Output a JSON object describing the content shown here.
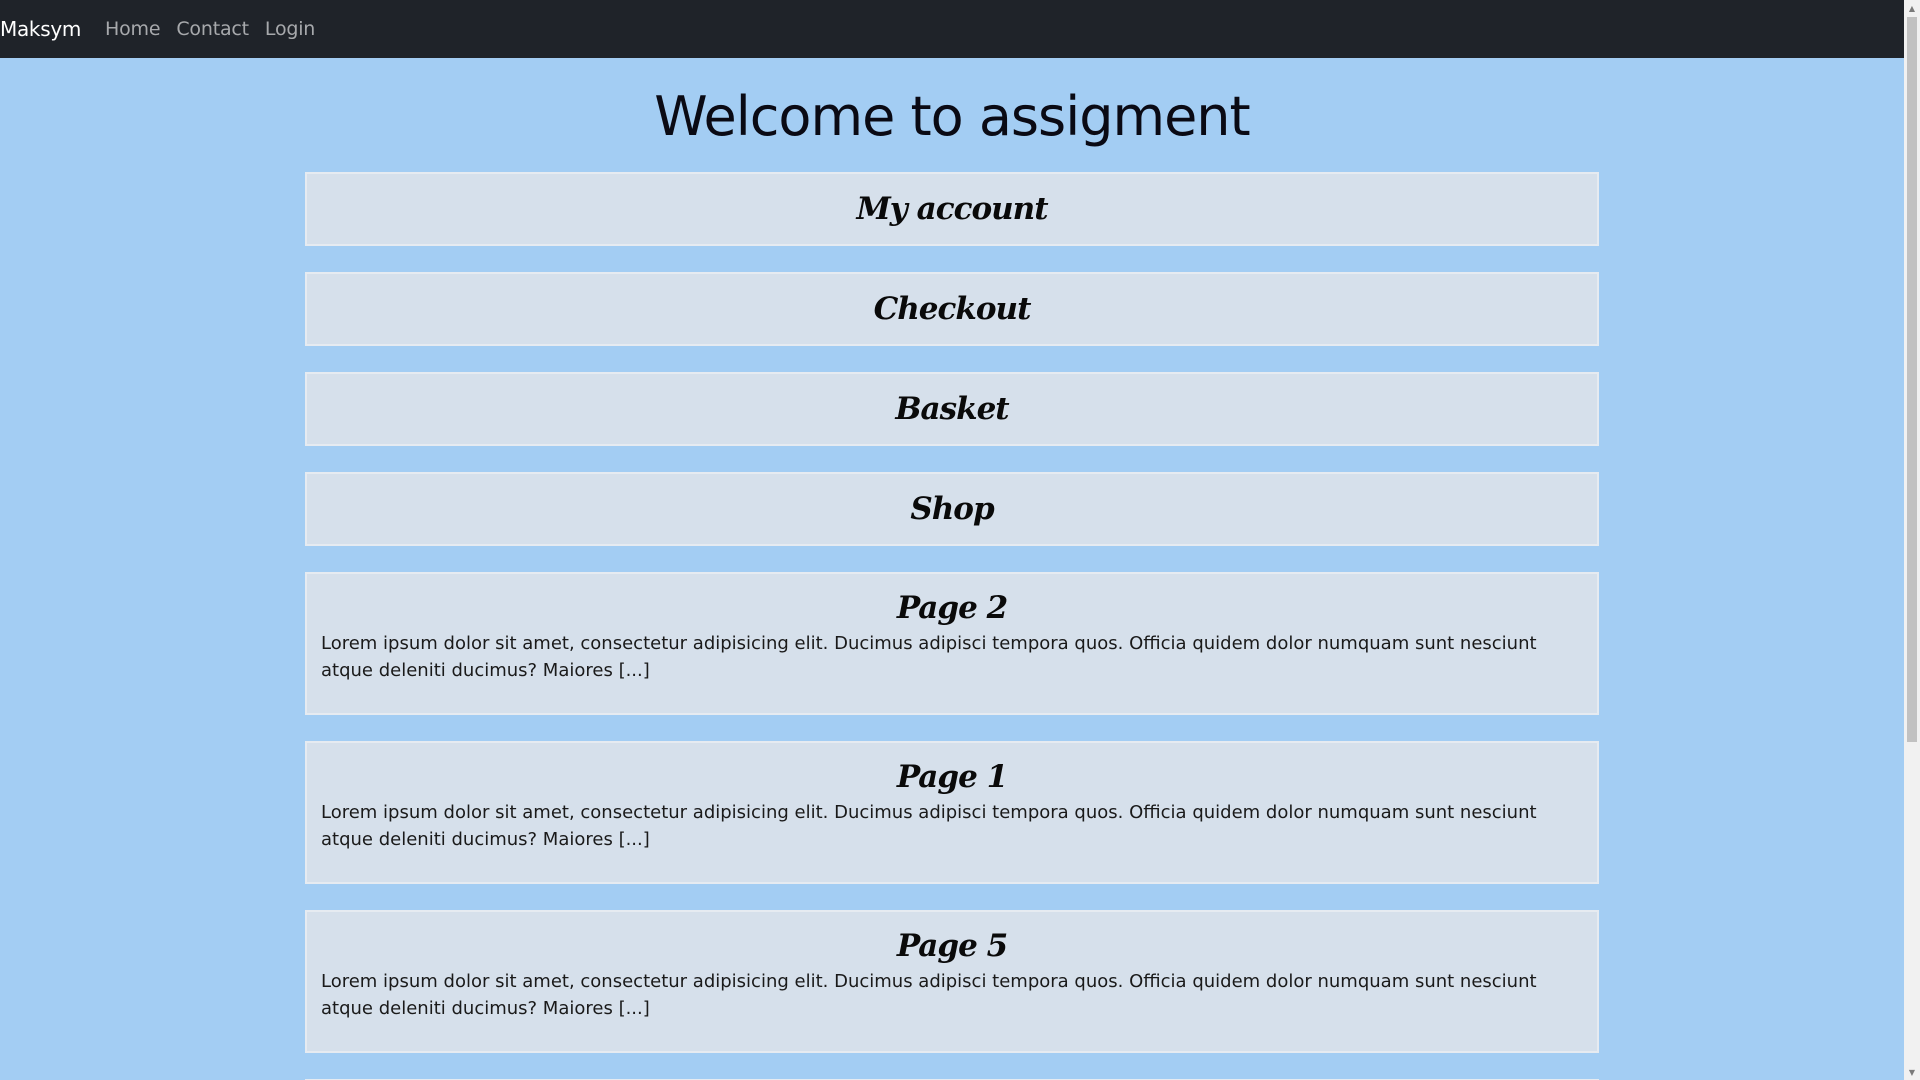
{
  "navbar": {
    "brand": "Maksym",
    "links": [
      "Home",
      "Contact",
      "Login"
    ]
  },
  "page_title": "Welcome to assigment",
  "link_cards": [
    {
      "label": "My account"
    },
    {
      "label": "Checkout"
    },
    {
      "label": "Basket"
    },
    {
      "label": "Shop"
    }
  ],
  "page_cards": [
    {
      "title": "Page 2",
      "excerpt": "Lorem ipsum dolor sit amet, consectetur adipisicing elit. Ducimus adipisci tempora quos. Officia quidem dolor numquam sunt nesciunt atque deleniti ducimus? Maiores [...]"
    },
    {
      "title": "Page 1",
      "excerpt": "Lorem ipsum dolor sit amet, consectetur adipisicing elit. Ducimus adipisci tempora quos. Officia quidem dolor numquam sunt nesciunt atque deleniti ducimus? Maiores [...]"
    },
    {
      "title": "Page 5",
      "excerpt": "Lorem ipsum dolor sit amet, consectetur adipisicing elit. Ducimus adipisci tempora quos. Officia quidem dolor numquam sunt nesciunt atque deleniti ducimus? Maiores [...]"
    }
  ],
  "colors": {
    "navbar_bg": "#1f2329",
    "page_bg": "#a3cdf3",
    "card_bg": "#d6e0eb"
  },
  "scrollbar": {
    "up_icon": "chevron-up-icon",
    "down_icon": "chevron-down-icon"
  }
}
